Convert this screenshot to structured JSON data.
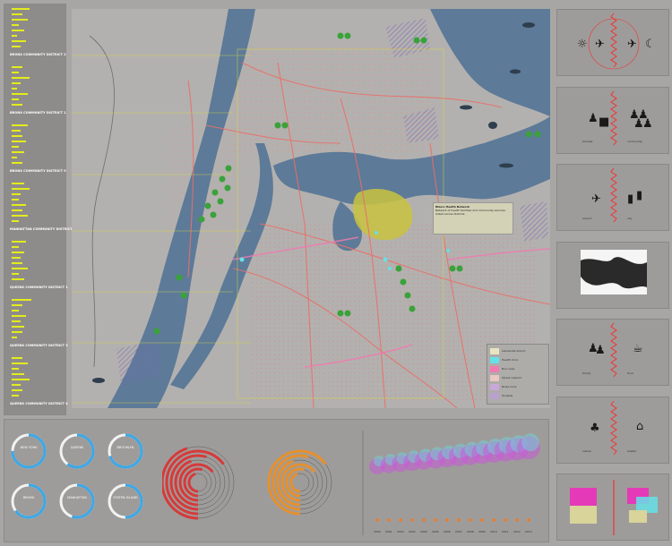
{
  "left_panel": {
    "districts": [
      {
        "label": "BRONX COMMUNITY DISTRICT 2",
        "bars": [
          0.5,
          0.3,
          0.45,
          0.2,
          0.35,
          0.15,
          0.4,
          0.25
        ]
      },
      {
        "label": "BRONX COMMUNITY DISTRICT 1",
        "bars": [
          0.3,
          0.2,
          0.5,
          0.25,
          0.15,
          0.45,
          0.2,
          0.3
        ]
      },
      {
        "label": "BRONX COMMUNITY DISTRICT 9",
        "bars": [
          0.45,
          0.25,
          0.3,
          0.4,
          0.2,
          0.35,
          0.15,
          0.3
        ]
      },
      {
        "label": "MANHATTAN COMMUNITY DISTRICT 11",
        "bars": [
          0.35,
          0.5,
          0.25,
          0.2,
          0.4,
          0.3,
          0.45,
          0.2
        ]
      },
      {
        "label": "QUEENS COMMUNITY DISTRICT 1",
        "bars": [
          0.4,
          0.2,
          0.35,
          0.25,
          0.3,
          0.45,
          0.2,
          0.35
        ]
      },
      {
        "label": "QUEENS COMMUNITY DISTRICT 3",
        "bars": [
          0.55,
          0.3,
          0.2,
          0.4,
          0.25,
          0.35,
          0.3,
          0.15
        ]
      },
      {
        "label": "QUEENS COMMUNITY DISTRICT 4",
        "bars": [
          0.3,
          0.45,
          0.2,
          0.35,
          0.5,
          0.25,
          0.3,
          0.2
        ]
      }
    ]
  },
  "map": {
    "callout": {
      "title": "Rikers Health Network",
      "body": "Network of health facilities and community services linked across districts"
    },
    "legend": [
      {
        "label": "LaGuardia Airport",
        "color": "#e8e4c0"
      },
      {
        "label": "Health clinic",
        "color": "#66e0e8"
      },
      {
        "label": "Bus route",
        "color": "#f07ab0"
      },
      {
        "label": "Street network",
        "color": "#e8c8c0"
      },
      {
        "label": "Noise zone",
        "color": "#c8a8d8"
      },
      {
        "label": "Hospital",
        "color": "#b8a0d0"
      }
    ],
    "colors": {
      "water": "#5d7a98",
      "land": "#b3b1af",
      "roads": "#e8706a",
      "parks": "#3aa23a",
      "airport": "#c8c340"
    }
  },
  "right_panels": [
    {
      "name": "day-night-flights",
      "caption_left": "",
      "caption_right": ""
    },
    {
      "name": "travellers",
      "caption_left": "traveler",
      "caption_right": "community"
    },
    {
      "name": "airport-city",
      "caption_left": "airport",
      "caption_right": "city"
    },
    {
      "name": "shoreline",
      "caption_left": "",
      "caption_right": ""
    },
    {
      "name": "family-meal",
      "caption_left": "family",
      "caption_right": "food"
    },
    {
      "name": "nature-shelter",
      "caption_left": "nature",
      "caption_right": "shelter"
    },
    {
      "name": "overlay",
      "caption_left": "",
      "caption_right": ""
    }
  ],
  "bottom": {
    "rings": [
      {
        "label": "NEW YORK",
        "pct": 0.75
      },
      {
        "label": "QUEENS",
        "pct": 0.6
      },
      {
        "label": "BROOKLYN",
        "pct": 0.7
      },
      {
        "label": "BRONX",
        "pct": 0.65
      },
      {
        "label": "MANHATTAN",
        "pct": 0.55
      },
      {
        "label": "STATEN ISLAND",
        "pct": 0.5
      }
    ],
    "red_arcs": 7,
    "orange_arcs": 6,
    "bubble_years": [
      "2000",
      "2001",
      "2002",
      "2003",
      "2004",
      "2005",
      "2006",
      "2007",
      "2008",
      "2009",
      "2010",
      "2011",
      "2012",
      "2013"
    ]
  }
}
